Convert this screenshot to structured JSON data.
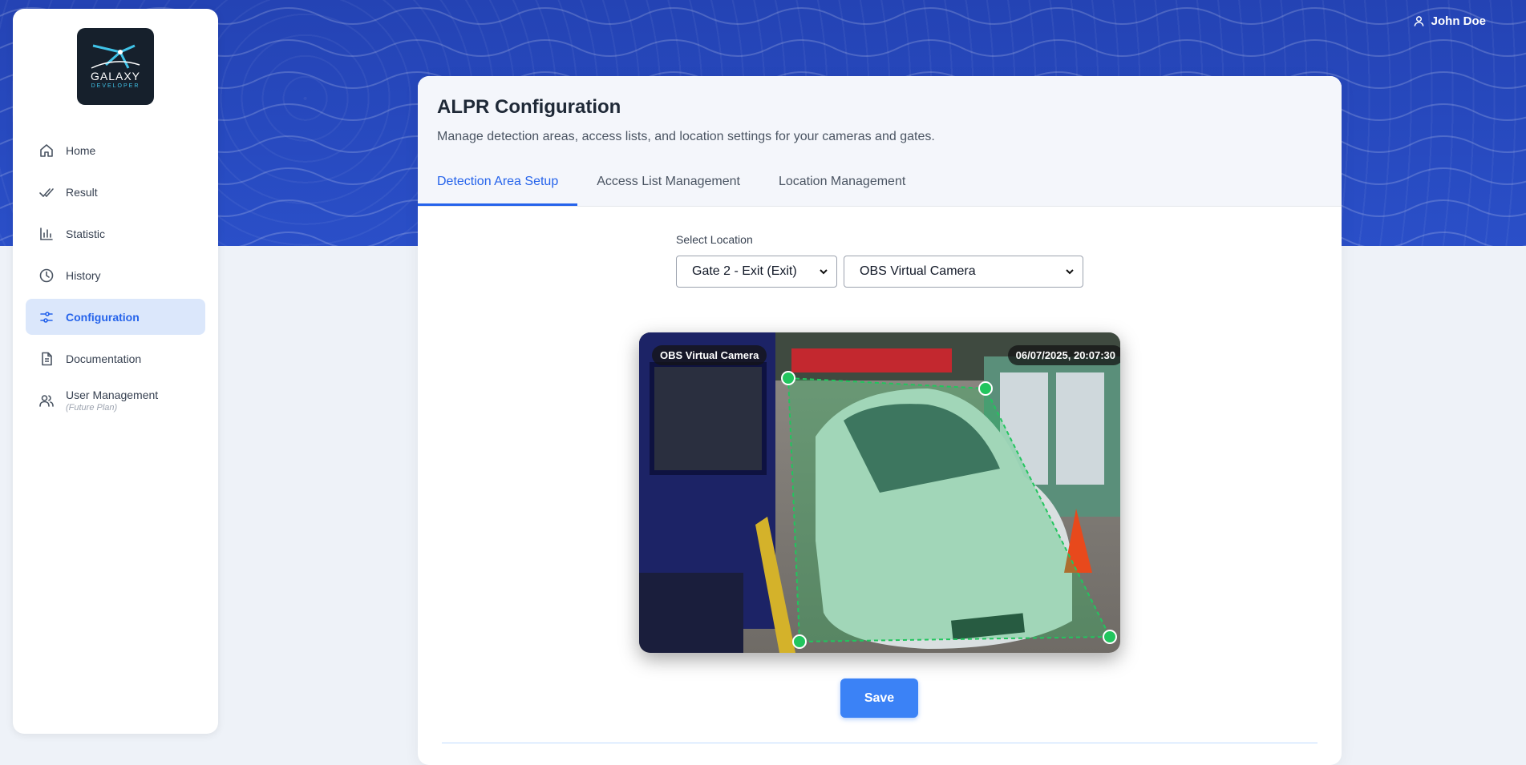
{
  "user": {
    "name": "John Doe",
    "icon": "user-icon"
  },
  "logo": {
    "title": "GALAXY",
    "subtitle": "DEVELOPER"
  },
  "sidebar": {
    "items": [
      {
        "label": "Home",
        "icon": "home-icon"
      },
      {
        "label": "Result",
        "icon": "double-check-icon"
      },
      {
        "label": "Statistic",
        "icon": "bar-chart-icon"
      },
      {
        "label": "History",
        "icon": "clock-icon"
      },
      {
        "label": "Configuration",
        "icon": "sliders-icon",
        "active": true
      },
      {
        "label": "Documentation",
        "icon": "document-icon"
      },
      {
        "label": "User Management",
        "sublabel": "(Future Plan)",
        "icon": "users-icon"
      }
    ]
  },
  "page": {
    "title": "ALPR Configuration",
    "subtitle": "Manage detection areas, access lists, and location settings for your cameras and gates.",
    "tabs": [
      "Detection Area Setup",
      "Access List Management",
      "Location Management"
    ],
    "active_tab": "Detection Area Setup"
  },
  "location": {
    "label": "Select Location",
    "gate_selected": "Gate 2 - Exit (Exit)",
    "camera_selected": "OBS Virtual Camera"
  },
  "camera": {
    "name_badge": "OBS Virtual Camera",
    "timestamp_badge": "06/07/2025, 20:07:30",
    "zone_color": "#22c55e"
  },
  "actions": {
    "save_label": "Save"
  },
  "colors": {
    "accent": "#2563eb",
    "hero": "#2a4fc8",
    "save": "#3b82f6"
  }
}
